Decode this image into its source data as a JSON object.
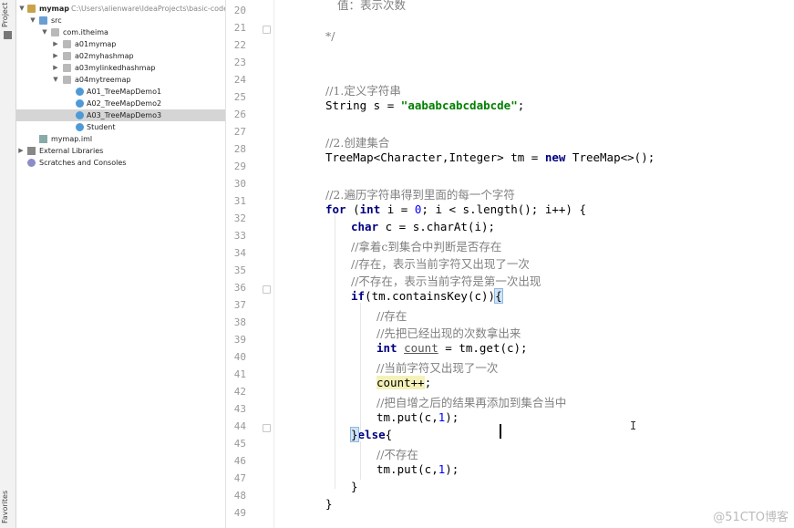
{
  "sidebar": {
    "project_label": "Project",
    "favorites_label": "Favorites"
  },
  "tree": {
    "root_name": "mymap",
    "root_path": "C:\\Users\\alienware\\IdeaProjects\\basic-code\\",
    "src": "src",
    "package": "com.itheima",
    "folders": [
      "a01mymap",
      "a02myhashmap",
      "a03mylinkedhashmap",
      "a04mytreemap"
    ],
    "classes": [
      "A01_TreeMapDemo1",
      "A02_TreeMapDemo2",
      "A03_TreeMapDemo3",
      "Student"
    ],
    "iml": "mymap.iml",
    "external_libraries": "External Libraries",
    "scratches": "Scratches and Consoles"
  },
  "editor": {
    "line_numbers": [
      "20",
      "21",
      "22",
      "23",
      "24",
      "25",
      "26",
      "27",
      "28",
      "29",
      "30",
      "31",
      "32",
      "33",
      "34",
      "35",
      "36",
      "37",
      "38",
      "39",
      "40",
      "41",
      "42",
      "43",
      "44",
      "45",
      "46",
      "47",
      "48",
      "49"
    ],
    "top_partial": "值：表示次数",
    "c21": "*/",
    "c24": "//1.定义字符串",
    "l25_a": "String s = ",
    "l25_str": "\"aababcabcdabcde\"",
    "l25_b": ";",
    "c27": "//2.创建集合",
    "l28_a": "TreeMap<Character,Integer> tm = ",
    "l28_kw": "new",
    "l28_b": " TreeMap<>();",
    "c30": "//2.遍历字符串得到里面的每一个字符",
    "l31_kw": "for",
    "l31_a": " (",
    "l31_kw2": "int",
    "l31_b": " i = ",
    "l31_n": "0",
    "l31_c": "; i < s.length(); i++) {",
    "l32_kw": "char",
    "l32_a": " c = s.charAt(i);",
    "c33": "//拿着c到集合中判断是否存在",
    "c34": "//存在，表示当前字符又出现了一次",
    "c35": "//不存在，表示当前字符是第一次出现",
    "l36_kw": "if",
    "l36_a": "(tm.containsKey(c))",
    "l36_b": "{",
    "c37": "//存在",
    "c38": "//先把已经出现的次数拿出来",
    "l39_kw": "int",
    "l39_var": "count",
    "l39_a": " = tm.get(c);",
    "c40": "//当前字符又出现了一次",
    "l41": "count++",
    "l41_b": ";",
    "c42": "//把自增之后的结果再添加到集合当中",
    "l43_a": "tm.put(c,",
    "l43_n": "1",
    "l43_b": ");",
    "l44_a": "}",
    "l44_kw": "else",
    "l44_b": "{",
    "c45": "//不存在",
    "l46_a": "tm.put(c,",
    "l46_n": "1",
    "l46_b": ");",
    "l47": "}",
    "l48": "}",
    "cursor_glyph": "I"
  },
  "watermark": "@51CTO博客"
}
